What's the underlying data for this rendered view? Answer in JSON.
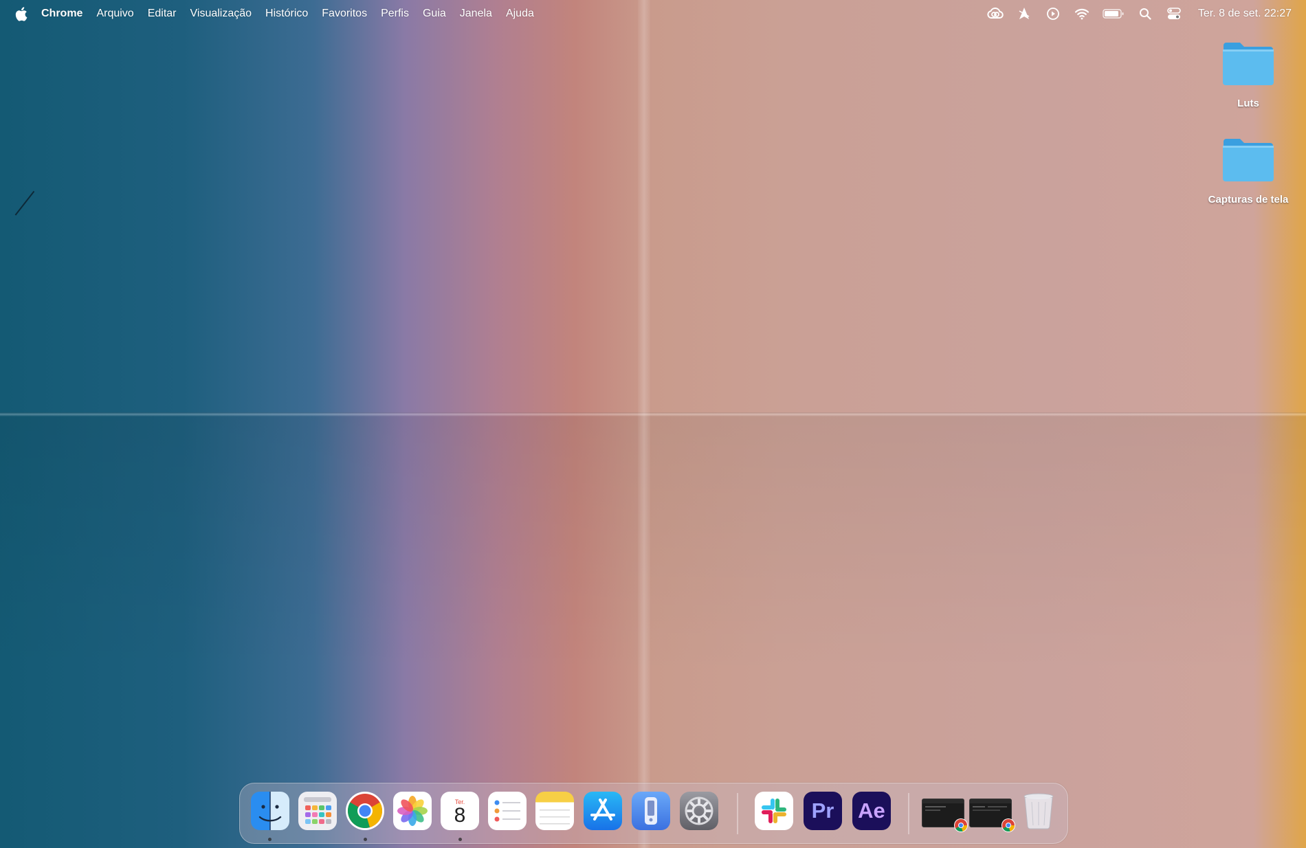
{
  "menubar": {
    "apple_icon": "apple-logo-icon",
    "app_name": "Chrome",
    "menus": [
      "Arquivo",
      "Editar",
      "Visualização",
      "Histórico",
      "Favoritos",
      "Perfis",
      "Guia",
      "Janela",
      "Ajuda"
    ],
    "status_icons": [
      "creative-cloud-icon",
      "location-arrow-icon",
      "play-circle-icon",
      "wifi-icon",
      "battery-icon",
      "spotlight-search-icon",
      "control-center-icon"
    ],
    "clock": "Ter. 8 de set.  22:27"
  },
  "desktop": {
    "folders": [
      {
        "label": "Luts",
        "icon": "folder-icon"
      },
      {
        "label": "Capturas de tela",
        "icon": "folder-icon"
      }
    ]
  },
  "dock": {
    "apps": [
      {
        "name": "finder",
        "icon": "finder-icon",
        "running": true
      },
      {
        "name": "launchpad",
        "icon": "launchpad-icon",
        "running": false
      },
      {
        "name": "chrome",
        "icon": "chrome-icon",
        "running": true
      },
      {
        "name": "photos",
        "icon": "photos-icon",
        "running": false
      },
      {
        "name": "calendar",
        "icon": "calendar-icon",
        "running": true,
        "day_label": "Ter.",
        "date": "8"
      },
      {
        "name": "reminders",
        "icon": "reminders-icon",
        "running": false
      },
      {
        "name": "notes",
        "icon": "notes-icon",
        "running": false
      },
      {
        "name": "app-store",
        "icon": "app-store-icon",
        "running": false
      },
      {
        "name": "remote",
        "icon": "remote-app-icon",
        "running": false
      },
      {
        "name": "system-preferences",
        "icon": "gear-icon",
        "running": false
      },
      {
        "name": "slack",
        "icon": "slack-icon",
        "running": false
      },
      {
        "name": "premiere-pro",
        "icon": "premiere-pro-icon",
        "running": false,
        "text": "Pr"
      },
      {
        "name": "after-effects",
        "icon": "after-effects-icon",
        "running": false,
        "text": "Ae"
      }
    ],
    "minimized_windows": [
      {
        "name": "minimized-chrome-window-1",
        "icon": "chrome-window-thumbnail-icon"
      },
      {
        "name": "minimized-chrome-window-2",
        "icon": "chrome-window-thumbnail-icon"
      }
    ],
    "trash_icon": "trash-icon",
    "colors": {
      "premiere_bg": "#1b0f5a",
      "premiere_text": "#9ea2ff",
      "aftereffects_text": "#c9a3ff",
      "folder_blue": "#56b6ec"
    }
  }
}
